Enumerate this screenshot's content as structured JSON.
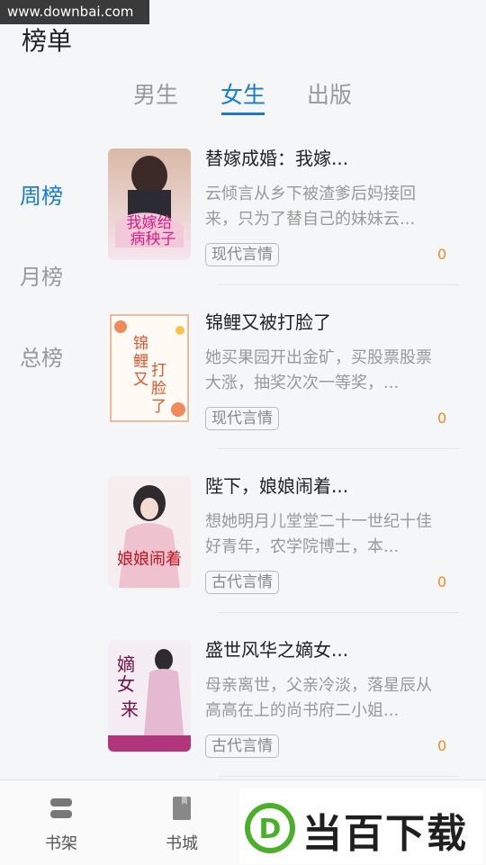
{
  "watermark_url": "www.downbai.com",
  "page_title": "榜单",
  "top_tabs": [
    {
      "label": "男生",
      "active": false
    },
    {
      "label": "女生",
      "active": true
    },
    {
      "label": "出版",
      "active": false
    }
  ],
  "side_nav": [
    {
      "label": "周榜",
      "active": true
    },
    {
      "label": "月榜",
      "active": false
    },
    {
      "label": "总榜",
      "active": false
    }
  ],
  "books": [
    {
      "title": "替嫁成婚：我嫁...",
      "desc": "云倾言从乡下被渣爹后妈接回来，只为了替自己的妹妹云...",
      "tag": "现代言情",
      "count": "0"
    },
    {
      "title": "锦鲤又被打脸了",
      "desc": "她买果园开出金矿，买股票股票大涨，抽奖次次一等奖，...",
      "tag": "现代言情",
      "count": "0"
    },
    {
      "title": "陛下，娘娘闹着...",
      "desc": "想她明月儿堂堂二十一世纪十佳好青年，农学院博士，本...",
      "tag": "古代言情",
      "count": "0"
    },
    {
      "title": "盛世风华之嫡女...",
      "desc": "母亲离世，父亲冷淡，落星辰从高高在上的尚书府二小姐...",
      "tag": "古代言情",
      "count": "0"
    }
  ],
  "bottom_nav": [
    {
      "label": "书架",
      "icon": "bookshelf-icon"
    },
    {
      "label": "书城",
      "icon": "book-icon"
    }
  ],
  "brand": {
    "letter": "D",
    "text": "当百下载"
  },
  "colors": {
    "accent": "#1a7bd3",
    "count": "#f08a24",
    "brand_green": "#4caf2a"
  }
}
